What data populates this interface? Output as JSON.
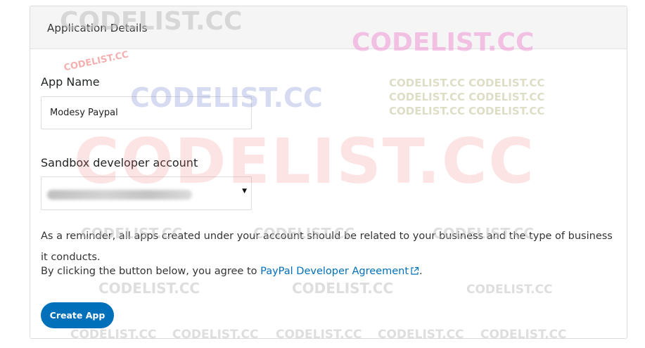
{
  "panel": {
    "title": "Application Details"
  },
  "form": {
    "app_name_label": "App Name",
    "app_name_value": "Modesy Paypal",
    "sandbox_label": "Sandbox developer account"
  },
  "reminder_text": "As a reminder, all apps created under your account should be related to your business and the type of business it conducts.",
  "agreement": {
    "prefix": "By clicking the button below, you agree to ",
    "link_text": "PayPal Developer Agreement",
    "suffix": "."
  },
  "create_button_label": "Create App",
  "watermark": {
    "text": "CODELIST.CC",
    "double": "CODELIST.CC CODELIST.CC"
  },
  "colors": {
    "link": "#0070ba",
    "button": "#0070ba"
  }
}
